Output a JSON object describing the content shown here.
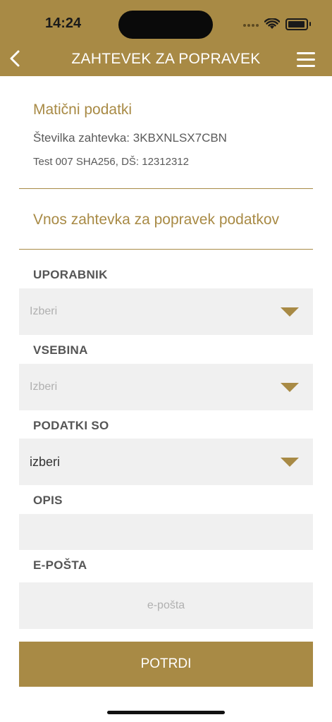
{
  "status_bar": {
    "time": "14:24"
  },
  "header": {
    "title": "ZAHTEVEK ZA POPRAVEK"
  },
  "basic_data": {
    "title": "Matični podatki",
    "request_number": "Številka zahtevka: 3KBXNLSX7CBN",
    "details": "Test 007 SHA256, DŠ: 12312312"
  },
  "form": {
    "title": "Vnos zahtevka za popravek podatkov",
    "user": {
      "label": "UPORABNIK",
      "placeholder": "Izberi"
    },
    "content": {
      "label": "VSEBINA",
      "placeholder": "Izberi"
    },
    "data_are": {
      "label": "PODATKI SO",
      "value": "izberi"
    },
    "description": {
      "label": "OPIS",
      "value": ""
    },
    "email": {
      "label": "E-POŠTA",
      "placeholder": "e-pošta"
    },
    "submit_label": "POTRDI"
  },
  "colors": {
    "accent": "#a88a45",
    "field_bg": "#f0f0f0"
  }
}
